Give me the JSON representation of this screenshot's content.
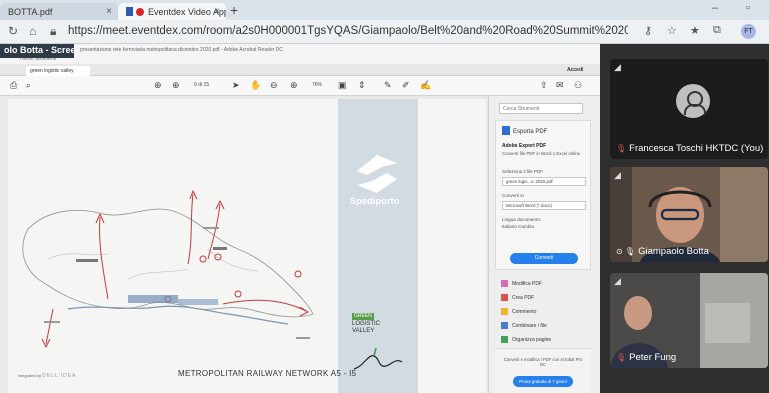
{
  "browser": {
    "tabs": [
      {
        "label": "BOTTA.pdf"
      },
      {
        "label": "Eventdex Video App"
      }
    ],
    "url": "https://meet.eventdex.com/room/a2s0H000001TgsYQAS/Giampaolo/Belt%20and%20Road%20Summit%202020/group/true/12-01-2020%2007:...",
    "profile_initials": "FT"
  },
  "share": {
    "title": "olo Botta - Screen",
    "reader": {
      "window_title": "presentazione rete ferroviaria metropolitana dicembre 2020.pdf - Adobe Acrobat Reader DC",
      "menu": "Home   Strumenti",
      "doc_tab": "green logistic valley",
      "accedi": "Accedi",
      "page_info": "9 di 15",
      "zoom": "76%"
    },
    "slide": {
      "logo_text": "Spediporto",
      "green_badge": "GREEN",
      "logistic_line1": "LOGISTIC",
      "logistic_line2": "VALLEY",
      "footer": "METROPOLITAN RAILWAY NETWORK  A5 - I5",
      "credit_prefix": "integrated by",
      "credit_brand": "DELL'IDEA"
    },
    "tools": {
      "search_placeholder": "Cerca Strumenti",
      "export_title": "Esporta PDF",
      "export_subtitle": "Adobe Export PDF",
      "export_desc": "Converti file PDF in Word o Excel online",
      "select_label": "Seleziona il file PDF",
      "file_value": "green logis...ic 2020.pdf",
      "convert_to_label": "Converti in",
      "format_value": "Microsoft Word (*.docx)",
      "lang_label": "Lingua documento:",
      "lang_value": "Italiano  Cambia",
      "convert_button": "Converti",
      "items": [
        "Modifica PDF",
        "Crea PDF",
        "Commento",
        "Combinare i file",
        "Organizza pagine"
      ],
      "promo_text": "Converti e modifica i PDF con Acrobat Pro DC",
      "promo_button": "Prova gratuita di 7 giorni"
    }
  },
  "participants": [
    {
      "name": "Francesca Toschi HKTDC (You)",
      "muted": true
    },
    {
      "name": "Giampaolo Botta",
      "muted": true
    },
    {
      "name": "Peter Fung",
      "muted": false
    }
  ],
  "colors": {
    "accent_blue": "#2680eb",
    "muted_red": "#e05656",
    "slide_blue_panel": "#d2dae2"
  }
}
